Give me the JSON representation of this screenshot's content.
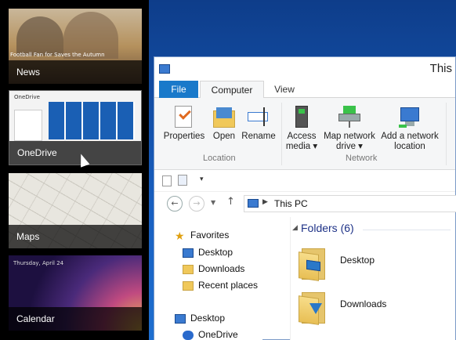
{
  "switcher": {
    "items": [
      {
        "label": "News",
        "caption": "Football Fan for Saves the Autumn"
      },
      {
        "label": "OneDrive",
        "caption": "OneDrive"
      },
      {
        "label": "Maps"
      },
      {
        "label": "Calendar",
        "caption": "Thursday, April 24"
      }
    ]
  },
  "window": {
    "title": "This",
    "tabs": [
      {
        "label": "File"
      },
      {
        "label": "Computer"
      },
      {
        "label": "View"
      }
    ],
    "ribbon": {
      "location_group": {
        "label": "Location",
        "buttons": [
          {
            "label": "Properties"
          },
          {
            "label": "Open"
          },
          {
            "label": "Rename"
          }
        ]
      },
      "network_group": {
        "label": "Network",
        "buttons": [
          {
            "line1": "Access",
            "line2": "media ▾"
          },
          {
            "line1": "Map network",
            "line2": "drive ▾"
          },
          {
            "line1": "Add a network",
            "line2": "location"
          }
        ]
      }
    },
    "address": {
      "path": "This PC"
    },
    "nav_pane": {
      "favorites": "Favorites",
      "items": [
        {
          "label": "Desktop"
        },
        {
          "label": "Downloads"
        },
        {
          "label": "Recent places"
        }
      ],
      "desktop": "Desktop",
      "onedrive": "OneDrive"
    },
    "content": {
      "header": "Folders (6)",
      "folders": [
        {
          "label": "Desktop"
        },
        {
          "label": "Downloads"
        }
      ]
    }
  },
  "colors": {
    "file_tab": "#1979ca",
    "desktop": "#1e6fd0",
    "folders_header": "#1e3287"
  }
}
